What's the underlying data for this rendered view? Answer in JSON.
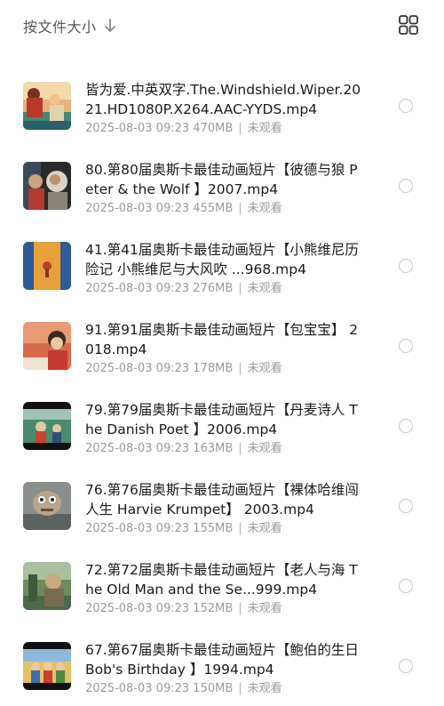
{
  "header": {
    "sort_label": "按文件大小",
    "sort_direction_icon": "arrow-down-icon",
    "view_toggle_icon": "grid-view-icon"
  },
  "videos": [
    {
      "title": "皆为爱.中英双字.The.Windshield.Wiper.2021.HD1080P.X264.AAC-YYDS.mp4",
      "date": "2025-08-03 09:23",
      "size": "470MB",
      "status": "未观看"
    },
    {
      "title": "80.第80届奥斯卡最佳动画短片【彼德与狼 Peter & the Wolf 】2007.mp4",
      "date": "2025-08-03 09:23",
      "size": "455MB",
      "status": "未观看"
    },
    {
      "title": "41.第41届奥斯卡最佳动画短片【小熊维尼历险记 小熊维尼与大风吹 ...968.mp4",
      "date": "2025-08-03 09:23",
      "size": "276MB",
      "status": "未观看"
    },
    {
      "title": "91.第91届奥斯卡最佳动画短片【包宝宝】 2018.mp4",
      "date": "2025-08-03 09:23",
      "size": "178MB",
      "status": "未观看"
    },
    {
      "title": "79.第79届奥斯卡最佳动画短片【丹麦诗人 The Danish Poet 】2006.mp4",
      "date": "2025-08-03 09:23",
      "size": "163MB",
      "status": "未观看"
    },
    {
      "title": "76.第76届奥斯卡最佳动画短片【裸体哈维闯人生 Harvie Krumpet】 2003.mp4",
      "date": "2025-08-03 09:23",
      "size": "155MB",
      "status": "未观看"
    },
    {
      "title": "72.第72届奥斯卡最佳动画短片【老人与海 The Old Man and the Se...999.mp4",
      "date": "2025-08-03 09:23",
      "size": "152MB",
      "status": "未观看"
    },
    {
      "title": "67.第67届奥斯卡最佳动画短片【鲍伯的生日 Bob's Birthday 】1994.mp4",
      "date": "2025-08-03 09:23",
      "size": "150MB",
      "status": "未观看"
    }
  ]
}
